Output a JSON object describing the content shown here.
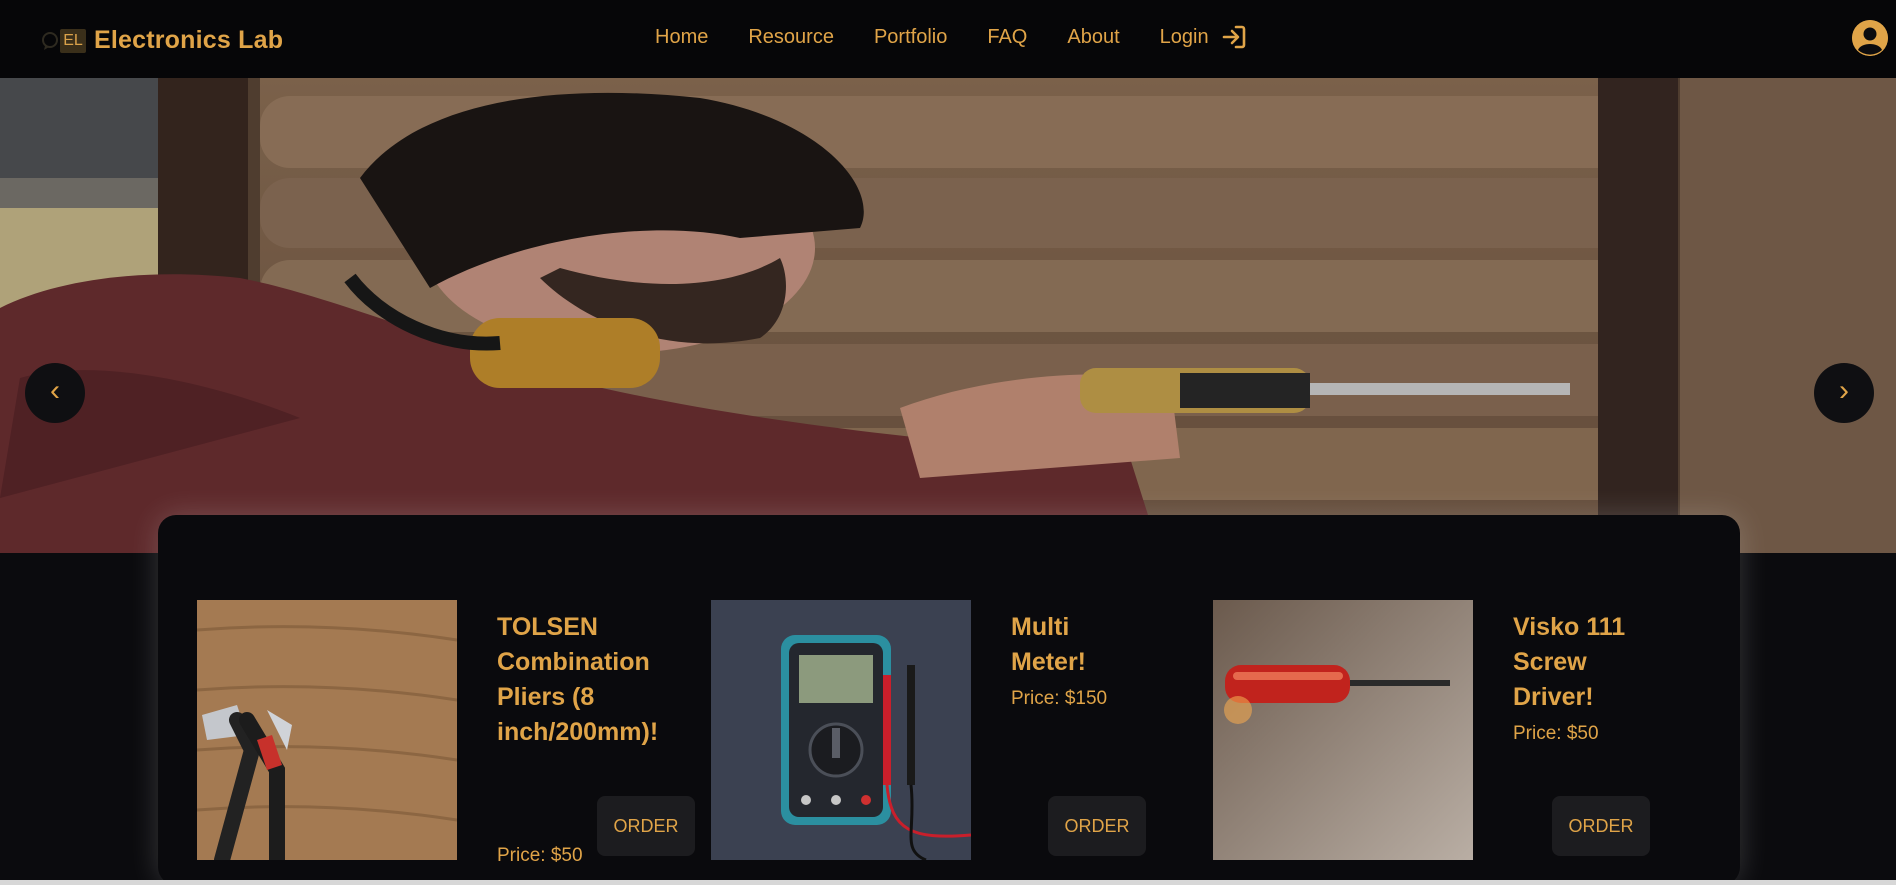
{
  "brand": {
    "logo_text": "EL",
    "name": "Electronics Lab"
  },
  "nav": {
    "items": [
      "Home",
      "Resource",
      "Portfolio",
      "FAQ",
      "About"
    ],
    "login_label": "Login"
  },
  "carousel": {
    "prev_label": "‹",
    "next_label": "›"
  },
  "products": [
    {
      "title": "TOLSEN Combination Pliers (8 inch/200mm)!",
      "price": "Price: $50",
      "order_label": "ORDER"
    },
    {
      "title": "Multi Meter!",
      "price": "Price: $150",
      "order_label": "ORDER"
    },
    {
      "title": "Visko 111 Screw Driver!",
      "price": "Price: $50",
      "order_label": "ORDER"
    }
  ],
  "icons": {
    "login": "sign-in-icon",
    "avatar": "user-circle-icon",
    "prev": "chevron-left-icon",
    "next": "chevron-right-icon"
  },
  "colors": {
    "accent": "#e0a448",
    "background": "#0b0b0e",
    "navbar": "#060608",
    "button": "#1c1c1f"
  }
}
